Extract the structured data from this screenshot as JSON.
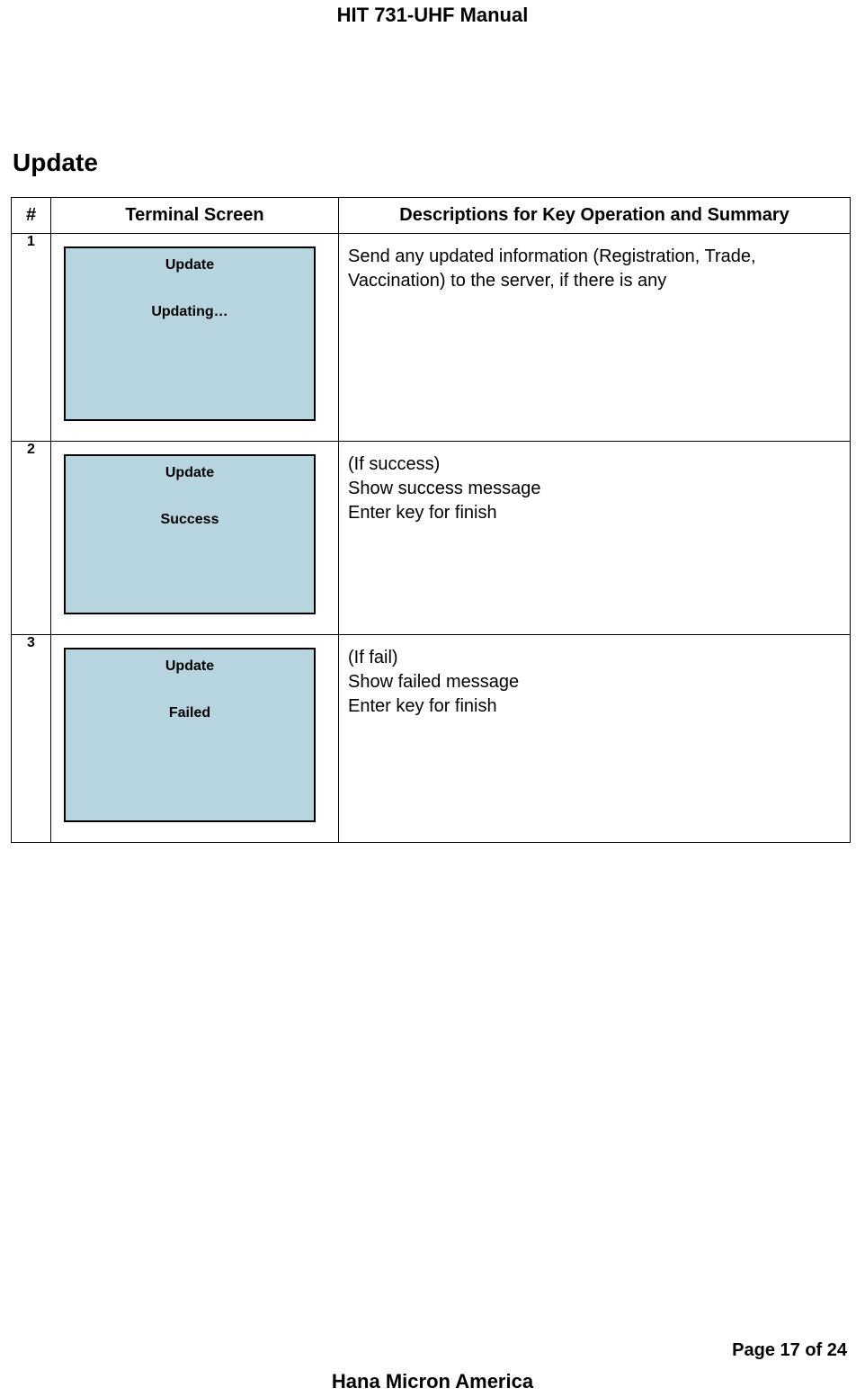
{
  "header": {
    "title": "HIT 731-UHF Manual"
  },
  "section": {
    "title": "Update"
  },
  "table": {
    "headers": {
      "num": "#",
      "terminal": "Terminal Screen",
      "desc": "Descriptions for Key Operation and Summary"
    },
    "rows": [
      {
        "num": "1",
        "terminal": {
          "title": "Update",
          "status": "Updating…"
        },
        "desc": "Send any updated information (Registration, Trade, Vaccination) to the server, if there is any"
      },
      {
        "num": "2",
        "terminal": {
          "title": "Update",
          "status": "Success"
        },
        "desc_line1": "(If success)",
        "desc_line2": "Show success message",
        "desc_line3": "Enter key for finish"
      },
      {
        "num": "3",
        "terminal": {
          "title": "Update",
          "status": "Failed"
        },
        "desc_line1": "(If fail)",
        "desc_line2": "Show failed message",
        "desc_line3": "Enter key for finish"
      }
    ]
  },
  "footer": {
    "page": "Page 17 of 24",
    "company": "Hana Micron America"
  }
}
